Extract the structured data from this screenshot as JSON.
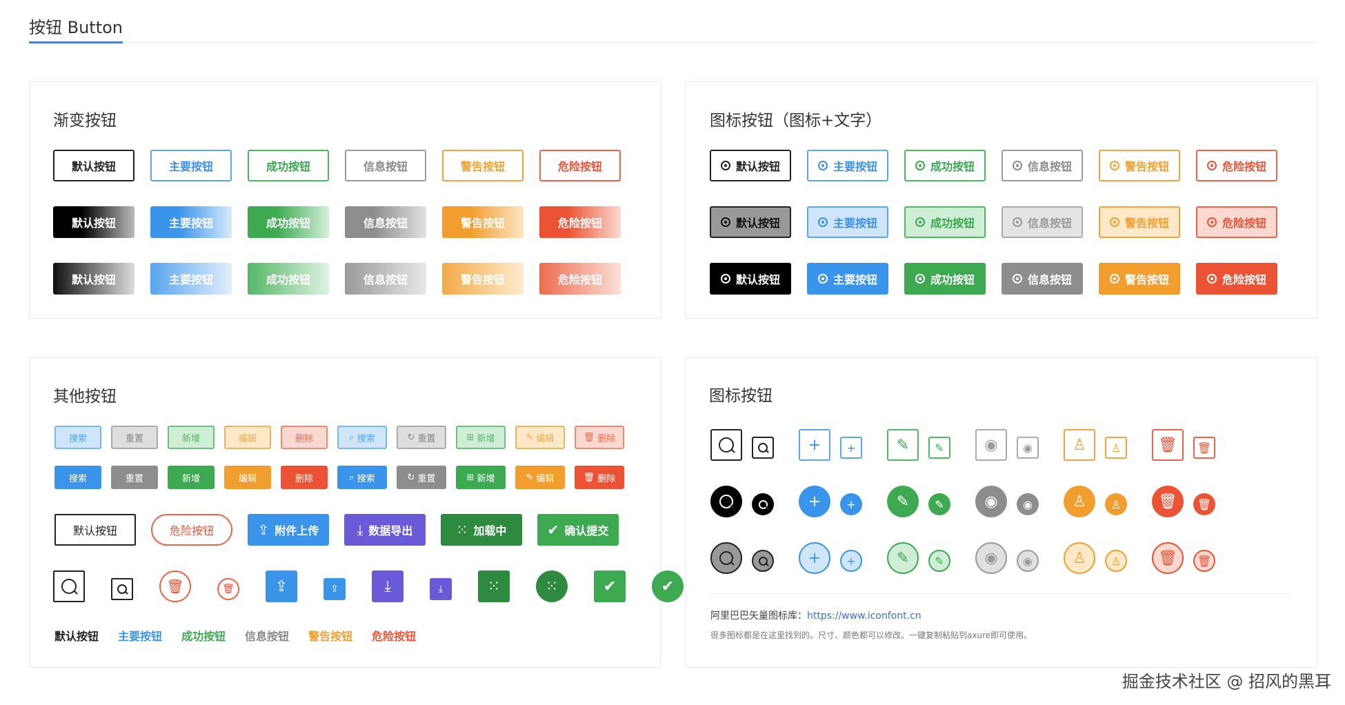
{
  "page": {
    "title": "按钮 Button"
  },
  "btn_labels": [
    "默认按钮",
    "主要按钮",
    "成功按钮",
    "信息按钮",
    "警告按钮",
    "危险按钮"
  ],
  "gradient_card": {
    "title": "渐变按钮"
  },
  "icontext_card": {
    "title": "图标按钮（图标+文字）"
  },
  "other_card": {
    "title": "其他按钮",
    "small_labels": [
      "搜索",
      "重置",
      "新增",
      "编辑",
      "删除",
      "搜索",
      "重置",
      "新增",
      "编辑",
      "删除"
    ],
    "mid": {
      "default": "默认按钮",
      "danger": "危险按钮",
      "upload": "附件上传",
      "export": "数据导出",
      "loading": "加载中",
      "confirm": "确认提交"
    }
  },
  "icon_card": {
    "title": "图标按钮",
    "icons": [
      "search-icon",
      "plus-icon",
      "edit-icon",
      "eye-icon",
      "user-icon",
      "trash-icon"
    ],
    "note_label": "阿里巴巴矢量图标库：",
    "note_link": "https://www.iconfont.cn",
    "note_desc": "很多图标都是在这里找到的。尺寸、颜色都可以修改。一键复制粘贴到axure即可使用。"
  },
  "watermark": "掘金技术社区 @ 招风的黑耳",
  "colors": {
    "primary": "#3a94ea",
    "success": "#3daa52",
    "info": "#8d8d8d",
    "warning": "#f19e2e",
    "danger": "#eb5334",
    "default": "#000000",
    "purple": "#6a5ad8"
  }
}
